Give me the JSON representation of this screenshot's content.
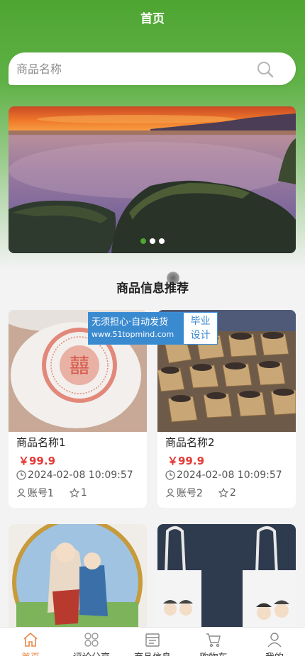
{
  "header": {
    "title": "首页"
  },
  "search": {
    "placeholder": "商品名称"
  },
  "banner": {
    "slides": 3,
    "active_index": 0
  },
  "section": {
    "title": "商品信息推荐"
  },
  "watermark": {
    "line1": "无须担心·自动发货",
    "line2": "www.51topmind.com",
    "tag1": "毕业",
    "tag2": "设计"
  },
  "products": [
    {
      "name": "商品名称1",
      "price": "￥99.9",
      "time": "2024-02-08 10:09:57",
      "account": "账号1",
      "favorites": "1"
    },
    {
      "name": "商品名称2",
      "price": "￥99.9",
      "time": "2024-02-08 10:09:57",
      "account": "账号2",
      "favorites": "2"
    }
  ],
  "tabbar": {
    "items": [
      {
        "label": "首页",
        "icon": "home-icon"
      },
      {
        "label": "评论分享",
        "icon": "grid-icon"
      },
      {
        "label": "商品信息",
        "icon": "calendar-icon"
      },
      {
        "label": "购物车",
        "icon": "cart-icon"
      },
      {
        "label": "我的",
        "icon": "user-icon"
      }
    ]
  },
  "colors": {
    "primary_green": "#4ea531",
    "price_red": "#e53935",
    "active_tab": "#e8894a"
  }
}
